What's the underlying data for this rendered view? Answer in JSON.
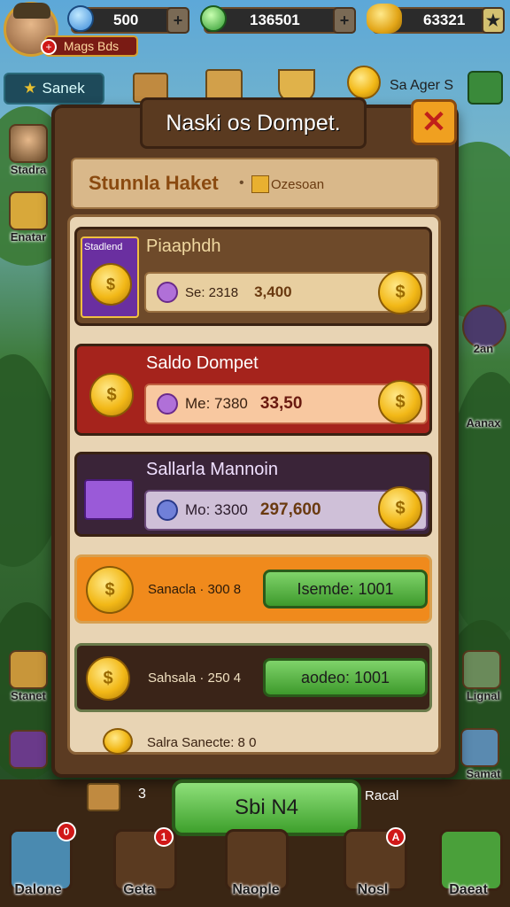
{
  "hud": {
    "gems": "500",
    "gold": "136501",
    "coins": "63321",
    "player_tag": "Mags Bds",
    "gem_plus": "+",
    "gold_plus": "+",
    "coins_plus": "★"
  },
  "top_nav": {
    "search_label": "Sanek",
    "right_label": "Sa Ager S"
  },
  "left_side": [
    {
      "label": "Stadra"
    },
    {
      "label": "Enatar"
    },
    {
      "label": "Stanet"
    }
  ],
  "right_side": [
    {
      "label": "2an"
    },
    {
      "label": "Aanax"
    },
    {
      "label": "Lignal"
    },
    {
      "label": "Samat"
    }
  ],
  "modal": {
    "title": "Naski os Dompet.",
    "close_symbol": "✕",
    "header_left": "Stunnla Haket",
    "header_right": "Ozesoan",
    "cards": [
      {
        "title": "Piaaphdh",
        "badge": "Stadlend",
        "price_text": "Se: 2318",
        "amount": "3,400"
      },
      {
        "title": "Saldo Dompet",
        "price_text": "Me: 7380",
        "amount": "33,50"
      },
      {
        "title": "Sallarla Mannoin",
        "price_text": "Mo: 3300",
        "amount": "297,600"
      }
    ],
    "offers": [
      {
        "label": "Sanacla · 300 8",
        "button": "Isemde: 1001"
      },
      {
        "label": "Sahsala · 250 4",
        "button": "aodeo: 1001"
      }
    ],
    "footer_text": "Salra Sanecte: 8 0"
  },
  "cta": {
    "label": "Sbi N4"
  },
  "below_modal": {
    "left_num": "3",
    "right_text": "Racal"
  },
  "bottom_bar": [
    {
      "label": "Dalone",
      "badge": "0"
    },
    {
      "label": "Geta",
      "badge": "1"
    },
    {
      "label": "Naople",
      "badge": ""
    },
    {
      "label": "Nosl",
      "badge": "A"
    },
    {
      "label": "Daeat",
      "badge": ""
    }
  ],
  "colors": {
    "card1": "#6e4a2a",
    "card2": "#a5231c",
    "card3": "#3a2438",
    "card4": "#f08a1c",
    "card5": "#3a2418",
    "accent_gold": "#f2b817"
  }
}
